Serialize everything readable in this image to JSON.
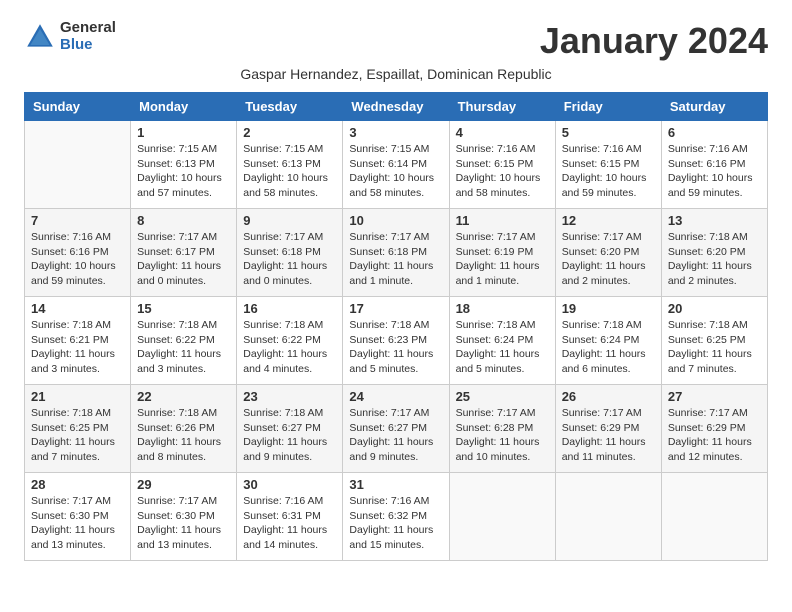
{
  "logo": {
    "general": "General",
    "blue": "Blue"
  },
  "title": "January 2024",
  "subtitle": "Gaspar Hernandez, Espaillat, Dominican Republic",
  "headers": [
    "Sunday",
    "Monday",
    "Tuesday",
    "Wednesday",
    "Thursday",
    "Friday",
    "Saturday"
  ],
  "weeks": [
    [
      {
        "day": "",
        "info": ""
      },
      {
        "day": "1",
        "info": "Sunrise: 7:15 AM\nSunset: 6:13 PM\nDaylight: 10 hours\nand 57 minutes."
      },
      {
        "day": "2",
        "info": "Sunrise: 7:15 AM\nSunset: 6:13 PM\nDaylight: 10 hours\nand 58 minutes."
      },
      {
        "day": "3",
        "info": "Sunrise: 7:15 AM\nSunset: 6:14 PM\nDaylight: 10 hours\nand 58 minutes."
      },
      {
        "day": "4",
        "info": "Sunrise: 7:16 AM\nSunset: 6:15 PM\nDaylight: 10 hours\nand 58 minutes."
      },
      {
        "day": "5",
        "info": "Sunrise: 7:16 AM\nSunset: 6:15 PM\nDaylight: 10 hours\nand 59 minutes."
      },
      {
        "day": "6",
        "info": "Sunrise: 7:16 AM\nSunset: 6:16 PM\nDaylight: 10 hours\nand 59 minutes."
      }
    ],
    [
      {
        "day": "7",
        "info": "Sunrise: 7:16 AM\nSunset: 6:16 PM\nDaylight: 10 hours\nand 59 minutes."
      },
      {
        "day": "8",
        "info": "Sunrise: 7:17 AM\nSunset: 6:17 PM\nDaylight: 11 hours\nand 0 minutes."
      },
      {
        "day": "9",
        "info": "Sunrise: 7:17 AM\nSunset: 6:18 PM\nDaylight: 11 hours\nand 0 minutes."
      },
      {
        "day": "10",
        "info": "Sunrise: 7:17 AM\nSunset: 6:18 PM\nDaylight: 11 hours\nand 1 minute."
      },
      {
        "day": "11",
        "info": "Sunrise: 7:17 AM\nSunset: 6:19 PM\nDaylight: 11 hours\nand 1 minute."
      },
      {
        "day": "12",
        "info": "Sunrise: 7:17 AM\nSunset: 6:20 PM\nDaylight: 11 hours\nand 2 minutes."
      },
      {
        "day": "13",
        "info": "Sunrise: 7:18 AM\nSunset: 6:20 PM\nDaylight: 11 hours\nand 2 minutes."
      }
    ],
    [
      {
        "day": "14",
        "info": "Sunrise: 7:18 AM\nSunset: 6:21 PM\nDaylight: 11 hours\nand 3 minutes."
      },
      {
        "day": "15",
        "info": "Sunrise: 7:18 AM\nSunset: 6:22 PM\nDaylight: 11 hours\nand 3 minutes."
      },
      {
        "day": "16",
        "info": "Sunrise: 7:18 AM\nSunset: 6:22 PM\nDaylight: 11 hours\nand 4 minutes."
      },
      {
        "day": "17",
        "info": "Sunrise: 7:18 AM\nSunset: 6:23 PM\nDaylight: 11 hours\nand 5 minutes."
      },
      {
        "day": "18",
        "info": "Sunrise: 7:18 AM\nSunset: 6:24 PM\nDaylight: 11 hours\nand 5 minutes."
      },
      {
        "day": "19",
        "info": "Sunrise: 7:18 AM\nSunset: 6:24 PM\nDaylight: 11 hours\nand 6 minutes."
      },
      {
        "day": "20",
        "info": "Sunrise: 7:18 AM\nSunset: 6:25 PM\nDaylight: 11 hours\nand 7 minutes."
      }
    ],
    [
      {
        "day": "21",
        "info": "Sunrise: 7:18 AM\nSunset: 6:25 PM\nDaylight: 11 hours\nand 7 minutes."
      },
      {
        "day": "22",
        "info": "Sunrise: 7:18 AM\nSunset: 6:26 PM\nDaylight: 11 hours\nand 8 minutes."
      },
      {
        "day": "23",
        "info": "Sunrise: 7:18 AM\nSunset: 6:27 PM\nDaylight: 11 hours\nand 9 minutes."
      },
      {
        "day": "24",
        "info": "Sunrise: 7:17 AM\nSunset: 6:27 PM\nDaylight: 11 hours\nand 9 minutes."
      },
      {
        "day": "25",
        "info": "Sunrise: 7:17 AM\nSunset: 6:28 PM\nDaylight: 11 hours\nand 10 minutes."
      },
      {
        "day": "26",
        "info": "Sunrise: 7:17 AM\nSunset: 6:29 PM\nDaylight: 11 hours\nand 11 minutes."
      },
      {
        "day": "27",
        "info": "Sunrise: 7:17 AM\nSunset: 6:29 PM\nDaylight: 11 hours\nand 12 minutes."
      }
    ],
    [
      {
        "day": "28",
        "info": "Sunrise: 7:17 AM\nSunset: 6:30 PM\nDaylight: 11 hours\nand 13 minutes."
      },
      {
        "day": "29",
        "info": "Sunrise: 7:17 AM\nSunset: 6:30 PM\nDaylight: 11 hours\nand 13 minutes."
      },
      {
        "day": "30",
        "info": "Sunrise: 7:16 AM\nSunset: 6:31 PM\nDaylight: 11 hours\nand 14 minutes."
      },
      {
        "day": "31",
        "info": "Sunrise: 7:16 AM\nSunset: 6:32 PM\nDaylight: 11 hours\nand 15 minutes."
      },
      {
        "day": "",
        "info": ""
      },
      {
        "day": "",
        "info": ""
      },
      {
        "day": "",
        "info": ""
      }
    ]
  ]
}
